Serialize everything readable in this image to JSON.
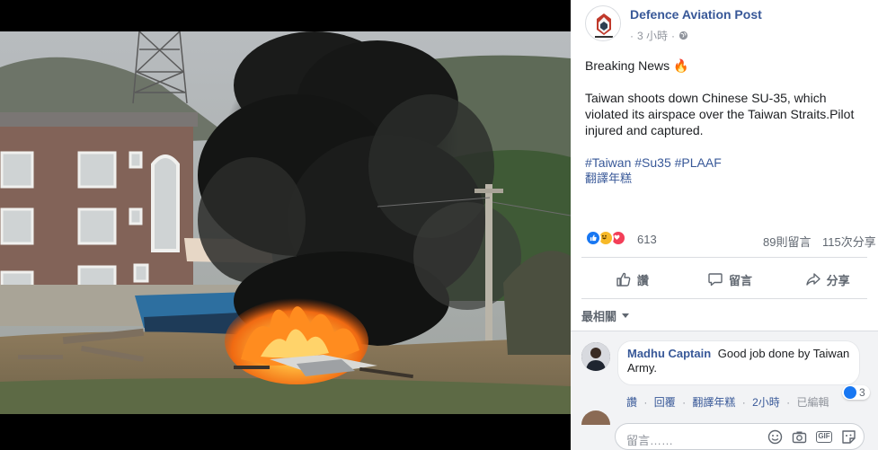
{
  "page": {
    "name": "Defence Aviation Post",
    "time": "3 小時",
    "separator": "·",
    "audience_icon": "globe-icon"
  },
  "post": {
    "headline": "Breaking News 🔥",
    "body": "Taiwan shoots down Chinese SU-35, which violated its airspace over the Taiwan Straits.Pilot injured and captured.",
    "hashtags": [
      "#Taiwan",
      "#Su35",
      "#PLAAF"
    ],
    "translate": "翻譯年糕"
  },
  "stats": {
    "reaction_icons": [
      "like-icon",
      "haha-icon",
      "love-icon"
    ],
    "reaction_count": "613",
    "comments": "89則留言",
    "shares": "115次分享"
  },
  "actions": {
    "like": "讚",
    "comment": "留言",
    "share": "分享"
  },
  "comments": {
    "sort_label": "最相關",
    "items": [
      {
        "author": "Madhu Captain",
        "text": "Good job done by Taiwan Army.",
        "reaction_count": "3",
        "like": "讚",
        "reply": "回覆",
        "translate": "翻譯年糕",
        "time": "2小時",
        "edited": "已編輯",
        "dot": "·"
      }
    ],
    "composer_placeholder": "留言……",
    "composer_tools": [
      "emoji-icon",
      "camera-icon",
      "gif-icon",
      "sticker-icon"
    ],
    "gif_label": "GIF"
  },
  "colors": {
    "link": "#385898",
    "meta": "#90949c",
    "like_blue": "#1877f2",
    "fire": "#ff7a1a"
  }
}
